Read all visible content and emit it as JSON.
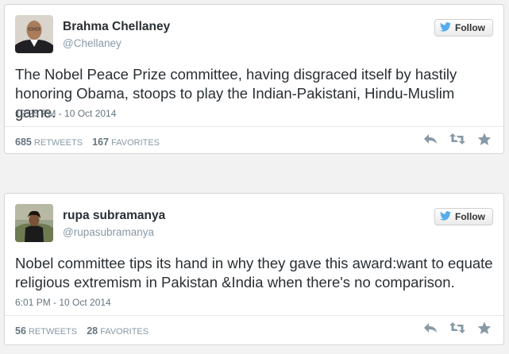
{
  "tweets": [
    {
      "author": "Brahma Chellaney",
      "handle": "@Chellaney",
      "follow_label": "Follow",
      "text": "The Nobel Peace Prize committee, having disgraced itself by hastily honoring Obama, stoops to play the Indian-Pakistani, Hindu-Muslim game.",
      "timestamp": "12:25 PM - 10 Oct 2014",
      "retweets_count": "685",
      "retweets_label": "RETWEETS",
      "favorites_count": "167",
      "favorites_label": "FAVORITES"
    },
    {
      "author": "rupa subramanya",
      "handle": "@rupasubramanya",
      "follow_label": "Follow",
      "text": "Nobel committee tips its hand in why they gave this award:want to equate religious extremism in Pakistan &India when there's no comparison.",
      "timestamp": "6:01 PM - 10 Oct 2014",
      "retweets_count": "56",
      "retweets_label": "RETWEETS",
      "favorites_count": "28",
      "favorites_label": "FAVORITES"
    }
  ],
  "colors": {
    "twitter_bird": "#55acee",
    "icon_gray": "#8899a6",
    "text": "#292f33"
  },
  "icons": [
    "twitter-bird-icon",
    "reply-icon",
    "retweet-icon",
    "favorite-star-icon"
  ]
}
